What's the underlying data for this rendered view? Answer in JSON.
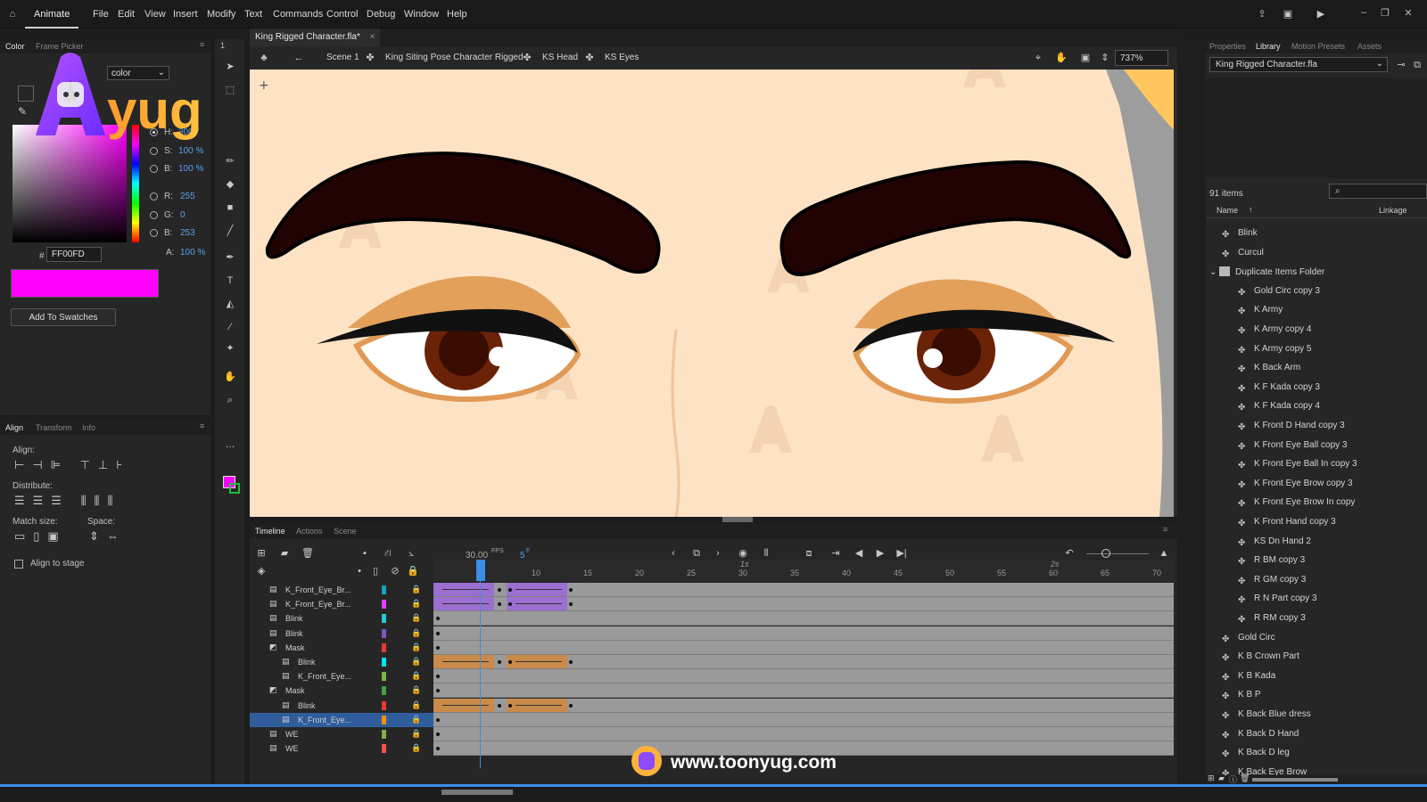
{
  "menubar": {
    "app_tab": "Animate",
    "items": [
      "File",
      "Edit",
      "View",
      "Insert",
      "Modify",
      "Text",
      "Commands",
      "Control",
      "Debug",
      "Window",
      "Help"
    ]
  },
  "color_panel": {
    "tabs": [
      "Color",
      "Frame Picker"
    ],
    "type_label": "color",
    "h_label": "H:",
    "h_value": "300 °",
    "s_label": "S:",
    "s_value": "100 %",
    "b_label": "B:",
    "b_value": "100 %",
    "r_label": "R:",
    "r_value": "255",
    "g_label": "G:",
    "g_value": "0",
    "bl_label": "B:",
    "bl_value": "253",
    "a_label": "A:",
    "a_value": "100 %",
    "hex_prefix": "#",
    "hex_value": "FF00FD",
    "add_swatch": "Add To Swatches",
    "current_color": "#ff00fd"
  },
  "align_panel": {
    "tabs": [
      "Align",
      "Transform",
      "Info"
    ],
    "align_label": "Align:",
    "distribute_label": "Distribute:",
    "match_label": "Match size:",
    "space_label": "Space:",
    "stage_label": "Align to stage"
  },
  "tools": {
    "page": "1"
  },
  "document": {
    "tab": "King Rigged Character.fla*",
    "breadcrumbs": [
      "Scene 1",
      "King Siting Pose Character Rigged",
      "KS Head",
      "KS Eyes"
    ],
    "zoom": "737%"
  },
  "timeline": {
    "tabs": [
      "Timeline",
      "Actions",
      "Scene"
    ],
    "fps_value": "30.00",
    "fps_unit": "FPS",
    "frame_value": "5",
    "frame_unit": "F",
    "ruler": [
      "5",
      "10",
      "15",
      "20",
      "25",
      "30",
      "35",
      "40",
      "45",
      "50",
      "55",
      "60",
      "65",
      "70"
    ],
    "ruler_seconds": [
      "1s",
      "2s"
    ],
    "layers": [
      {
        "name": "K_Front_Eye_Br...",
        "color": "#17a2b8",
        "indent": 0,
        "type": "purple"
      },
      {
        "name": "K_Front_Eye_Br...",
        "color": "#e040fb",
        "indent": 0,
        "type": "purple"
      },
      {
        "name": "Blink",
        "color": "#26c6da",
        "indent": 0,
        "type": "empty"
      },
      {
        "name": "Blink",
        "color": "#7e57c2",
        "indent": 0,
        "type": "empty"
      },
      {
        "name": "Mask",
        "color": "#e53935",
        "indent": 0,
        "type": "empty"
      },
      {
        "name": "Blink",
        "color": "#00e5ff",
        "indent": 1,
        "type": "orange"
      },
      {
        "name": "K_Front_Eye...",
        "color": "#7cb342",
        "indent": 1,
        "type": "empty"
      },
      {
        "name": "Mask",
        "color": "#43a047",
        "indent": 0,
        "type": "empty"
      },
      {
        "name": "Blink",
        "color": "#e53935",
        "indent": 1,
        "type": "orange"
      },
      {
        "name": "K_Front_Eye...",
        "color": "#fb8c00",
        "indent": 1,
        "type": "empty",
        "selected": true
      },
      {
        "name": "WE",
        "color": "#7cb342",
        "indent": 0,
        "type": "empty"
      },
      {
        "name": "WE",
        "color": "#ef5350",
        "indent": 0,
        "type": "empty"
      }
    ]
  },
  "library": {
    "tabs": [
      "Properties",
      "Library",
      "Motion Presets",
      "Assets"
    ],
    "file": "King Rigged Character.fla",
    "count": "91 items",
    "col_name": "Name",
    "col_linkage": "Linkage",
    "items": [
      {
        "name": "Blink",
        "indent": 0
      },
      {
        "name": "Curcul",
        "indent": 0
      },
      {
        "name": "Duplicate Items Folder",
        "indent": 0,
        "folder": true
      },
      {
        "name": "Gold Circ copy 3",
        "indent": 1
      },
      {
        "name": "K Army",
        "indent": 1
      },
      {
        "name": "K Army copy 4",
        "indent": 1
      },
      {
        "name": "K Army copy 5",
        "indent": 1
      },
      {
        "name": "K Back Arm",
        "indent": 1
      },
      {
        "name": "K F Kada copy 3",
        "indent": 1
      },
      {
        "name": "K F Kada copy 4",
        "indent": 1
      },
      {
        "name": "K Front D Hand copy 3",
        "indent": 1
      },
      {
        "name": "K Front Eye Ball copy 3",
        "indent": 1
      },
      {
        "name": "K Front Eye Ball In copy 3",
        "indent": 1
      },
      {
        "name": "K Front Eye Brow copy 3",
        "indent": 1
      },
      {
        "name": "K Front Eye Brow In copy",
        "indent": 1
      },
      {
        "name": "K Front Hand copy 3",
        "indent": 1
      },
      {
        "name": "KS Dn Hand 2",
        "indent": 1
      },
      {
        "name": "R BM copy 3",
        "indent": 1
      },
      {
        "name": "R GM copy 3",
        "indent": 1
      },
      {
        "name": "R N Part copy 3",
        "indent": 1
      },
      {
        "name": "R RM copy 3",
        "indent": 1
      },
      {
        "name": "Gold Circ",
        "indent": 0
      },
      {
        "name": "K B Crown Part",
        "indent": 0
      },
      {
        "name": "K B Kada",
        "indent": 0
      },
      {
        "name": "K B P",
        "indent": 0
      },
      {
        "name": "K Back Blue dress",
        "indent": 0
      },
      {
        "name": "K Back D Hand",
        "indent": 0
      },
      {
        "name": "K Back D leg",
        "indent": 0
      },
      {
        "name": "K Back Eye Brow",
        "indent": 0
      }
    ]
  },
  "watermark": {
    "url": "www.toonyug.com",
    "logo": "yug"
  }
}
